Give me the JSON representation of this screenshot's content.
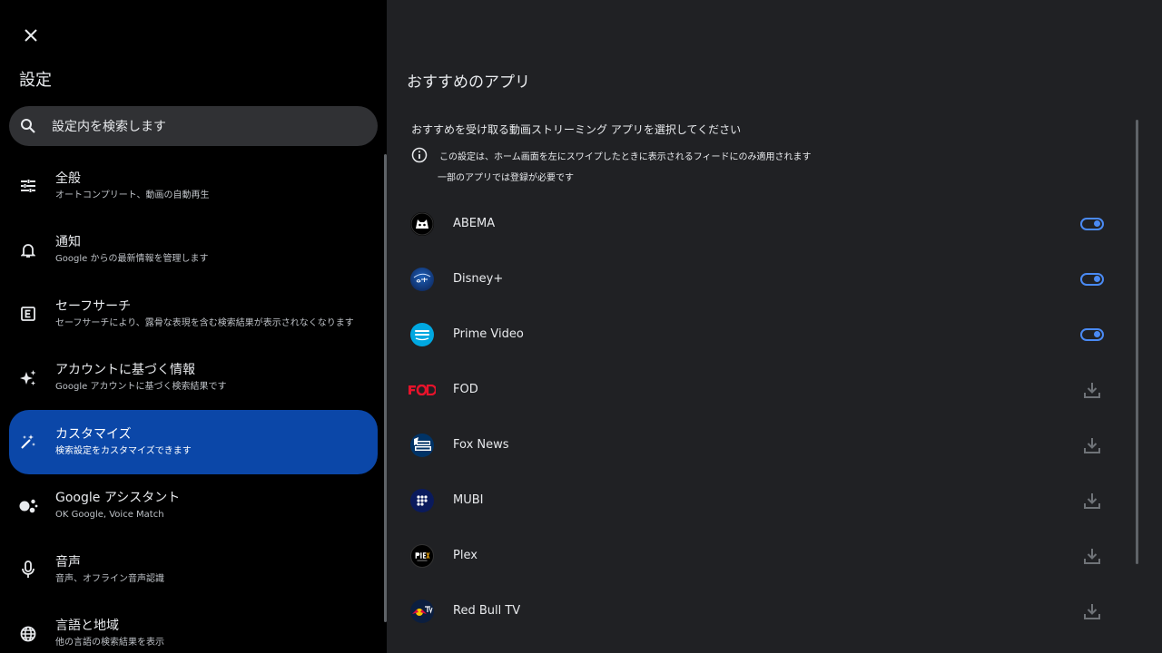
{
  "left": {
    "title": "設定",
    "search": {
      "placeholder": "設定内を検索します"
    },
    "items": [
      {
        "title": "全般",
        "subtitle": "オートコンプリート、動画の自動再生",
        "icon": "tune-icon"
      },
      {
        "title": "通知",
        "subtitle": "Google からの最新情報を管理します",
        "icon": "bell-icon"
      },
      {
        "title": "セーフサーチ",
        "subtitle": "セーフサーチにより、露骨な表現を含む検索結果が表示されなくなります",
        "icon": "explicit-icon"
      },
      {
        "title": "アカウントに基づく情報",
        "subtitle": "Google アカウントに基づく検索結果です",
        "icon": "sparkle-icon"
      },
      {
        "title": "カスタマイズ",
        "subtitle": "検索設定をカスタマイズできます",
        "icon": "magic-wand-icon",
        "active": true
      },
      {
        "title": "Google アシスタント",
        "subtitle": "OK Google, Voice Match",
        "icon": "assistant-icon"
      },
      {
        "title": "音声",
        "subtitle": "音声、オフライン音声認識",
        "icon": "mic-icon"
      },
      {
        "title": "言語と地域",
        "subtitle": "他の言語の検索結果を表示",
        "icon": "globe-icon"
      }
    ]
  },
  "right": {
    "title": "おすすめのアプリ",
    "description": "おすすめを受け取る動画ストリーミング アプリを選択してください",
    "info": "この設定は、ホーム画面を左にスワイプしたときに表示されるフィードにのみ適用されます",
    "note": "一部のアプリでは登録が必要です",
    "apps": [
      {
        "name": "ABEMA",
        "state": "enabled",
        "logo_text": "ABEMA"
      },
      {
        "name": "Disney+",
        "state": "enabled",
        "logo_text": "Disney+"
      },
      {
        "name": "Prime Video",
        "state": "enabled",
        "logo_text": "prime video"
      },
      {
        "name": "FOD",
        "state": "download",
        "logo_text": "FOD"
      },
      {
        "name": "Fox News",
        "state": "download",
        "logo_text": "FOX NEWS"
      },
      {
        "name": "MUBI",
        "state": "download",
        "logo_text": ""
      },
      {
        "name": "Plex",
        "state": "download",
        "logo_text": "PLEX"
      },
      {
        "name": "Red Bull TV",
        "state": "download",
        "logo_text": "TV"
      }
    ]
  },
  "colors": {
    "accent": "#4a8af4",
    "active_nav": "#0b47a8",
    "panel_bg": "#202124",
    "left_bg": "#000000",
    "search_bg": "#303134"
  }
}
